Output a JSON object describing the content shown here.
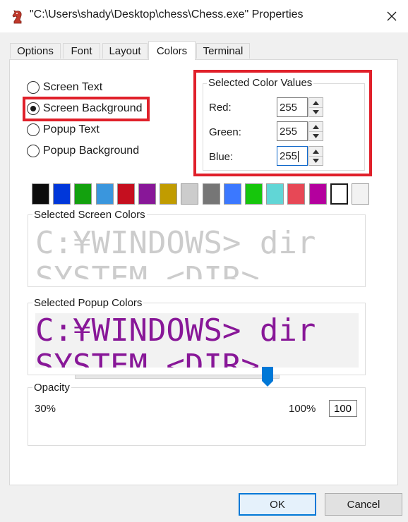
{
  "window": {
    "title": "\"C:\\Users\\shady\\Desktop\\chess\\Chess.exe\" Properties",
    "app_icon": "chess-knight-icon",
    "close_icon": "close-icon"
  },
  "tabs": [
    {
      "label": "Options",
      "active": false
    },
    {
      "label": "Font",
      "active": false
    },
    {
      "label": "Layout",
      "active": false
    },
    {
      "label": "Colors",
      "active": true
    },
    {
      "label": "Terminal",
      "active": false
    }
  ],
  "radios": [
    {
      "label": "Screen Text",
      "checked": false
    },
    {
      "label": "Screen Background",
      "checked": true
    },
    {
      "label": "Popup Text",
      "checked": false
    },
    {
      "label": "Popup Background",
      "checked": false
    }
  ],
  "selected_color_values": {
    "legend": "Selected Color Values",
    "red_label": "Red:",
    "red_value": "255",
    "green_label": "Green:",
    "green_value": "255",
    "blue_label": "Blue:",
    "blue_value": "255"
  },
  "palette": [
    "#0c0c0c",
    "#0037da",
    "#13a10e",
    "#3a96dd",
    "#c50f1f",
    "#881798",
    "#c19c00",
    "#cccccc",
    "#767676",
    "#3b78ff",
    "#16c60c",
    "#61d6d6",
    "#e74856",
    "#b4009e",
    "#ffffff",
    "#f2f2f2"
  ],
  "palette_selected_index": 14,
  "screen_colors": {
    "legend": "Selected Screen Colors",
    "line1": "C:¥WINDOWS> dir",
    "line2": "SYSTEM         <DIR>",
    "text_color": "#cccccc",
    "bg_color": "#ffffff"
  },
  "popup_colors": {
    "legend": "Selected Popup Colors",
    "line1": "C:¥WINDOWS> dir",
    "line2": "SYSTEM         <DIR>",
    "text_color": "#881798",
    "bg_color": "#f2f2f2"
  },
  "opacity": {
    "legend": "Opacity",
    "min_label": "30%",
    "max_label": "100%",
    "value": "100"
  },
  "buttons": {
    "ok": "OK",
    "cancel": "Cancel"
  },
  "accent_colors": {
    "highlight_red": "#e0202a",
    "slider_blue": "#0078d7"
  }
}
